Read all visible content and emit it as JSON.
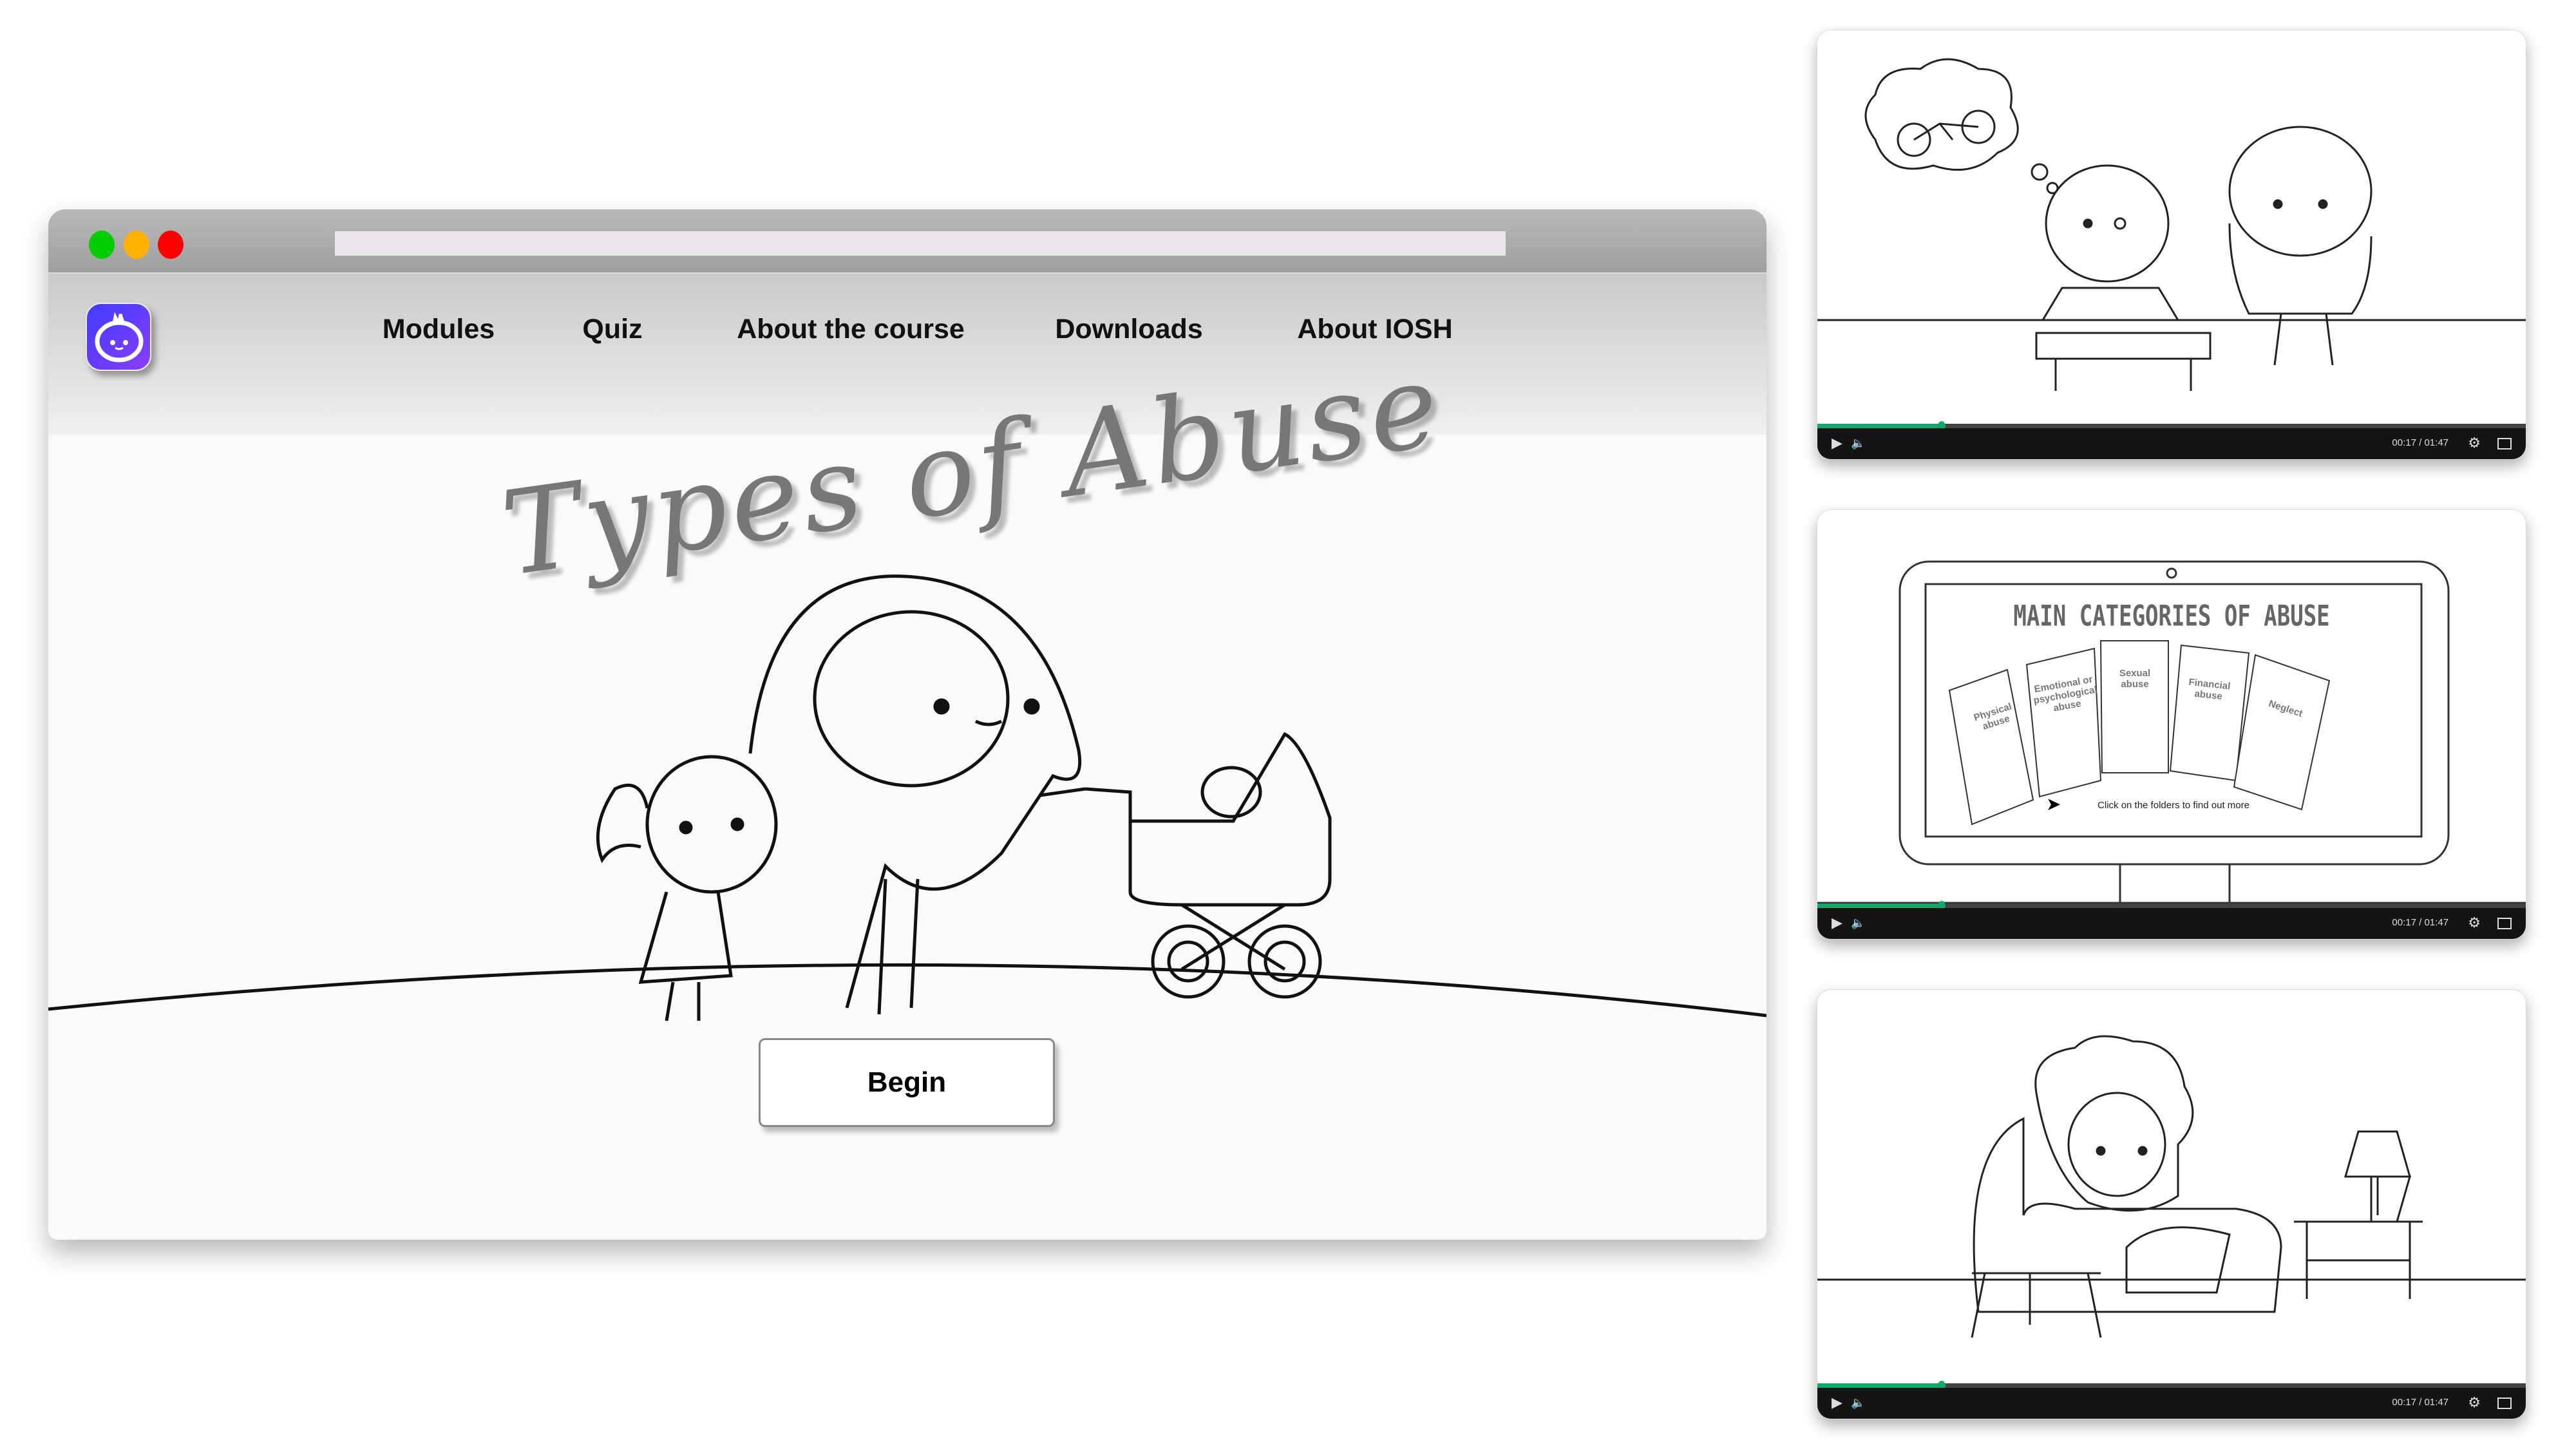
{
  "browser": {
    "traffic_lights": [
      "#00cc00",
      "#ffb000",
      "#ff0000"
    ]
  },
  "logo": {
    "icon": "robot-face-logo",
    "colors": [
      "#3f3cff",
      "#8a3cff"
    ]
  },
  "nav": {
    "items": [
      {
        "label": "Modules"
      },
      {
        "label": "Quiz"
      },
      {
        "label": "About the course"
      },
      {
        "label": "Downloads"
      },
      {
        "label": "About IOSH"
      }
    ]
  },
  "hero": {
    "title": "Types of Abuse",
    "begin_label": "Begin"
  },
  "videos": [
    {
      "time": "00:17 / 01:47",
      "progress": 0.17
    },
    {
      "time": "00:17 / 01:47",
      "progress": 0.17,
      "slide": {
        "title": "MAIN CATEGORIES OF ABUSE",
        "folders": [
          "Physical abuse",
          "Emotional or psychological abuse",
          "Sexual abuse",
          "Financial abuse",
          "Neglect"
        ],
        "hint": "Click on the folders to find out more"
      }
    },
    {
      "time": "00:17 / 01:47",
      "progress": 0.17
    }
  ],
  "accent": "#10a86c"
}
